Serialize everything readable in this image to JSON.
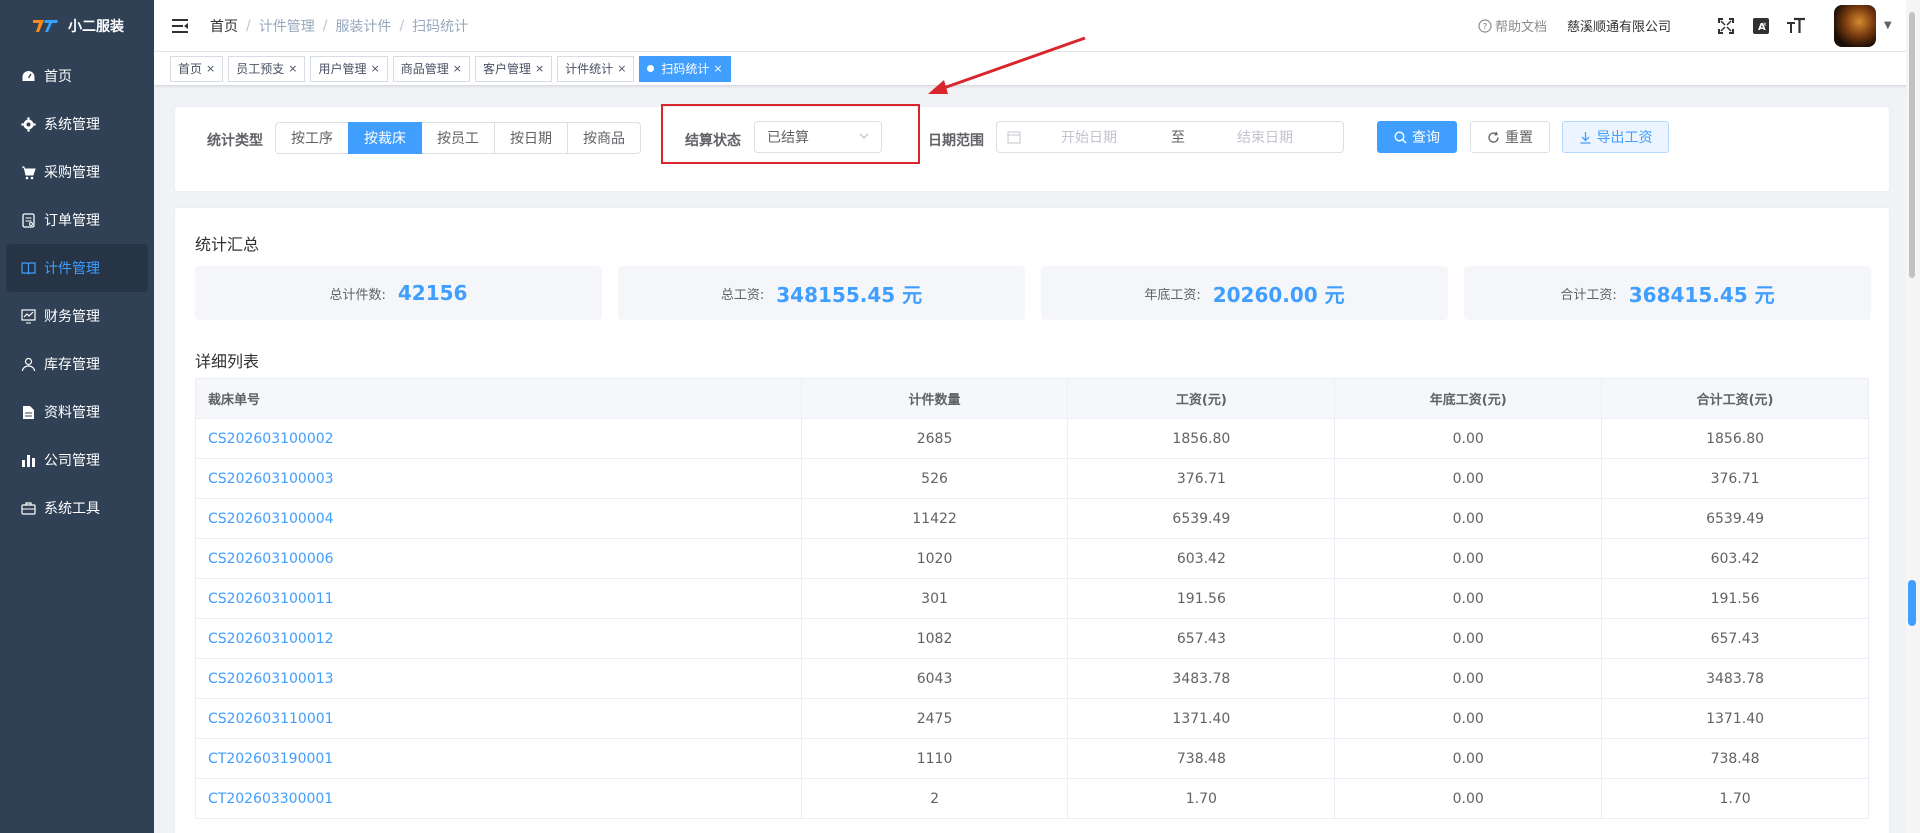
{
  "app": {
    "name": "小二服装"
  },
  "sidebar": {
    "items": [
      {
        "label": "首页",
        "icon": "dashboard-icon",
        "active": false
      },
      {
        "label": "系统管理",
        "icon": "gear-icon",
        "active": false
      },
      {
        "label": "采购管理",
        "icon": "cart-icon",
        "active": false
      },
      {
        "label": "订单管理",
        "icon": "order-icon",
        "active": false
      },
      {
        "label": "计件管理",
        "icon": "book-icon",
        "active": true
      },
      {
        "label": "财务管理",
        "icon": "chart-line-icon",
        "active": false
      },
      {
        "label": "库存管理",
        "icon": "user-icon",
        "active": false
      },
      {
        "label": "资料管理",
        "icon": "document-icon",
        "active": false
      },
      {
        "label": "公司管理",
        "icon": "bar-chart-icon",
        "active": false
      },
      {
        "label": "系统工具",
        "icon": "toolbox-icon",
        "active": false
      }
    ]
  },
  "header": {
    "breadcrumb": [
      "首页",
      "计件管理",
      "服装计件",
      "扫码统计"
    ],
    "help": "帮助文档",
    "company": "慈溪顺通有限公司"
  },
  "tags": [
    {
      "label": "首页",
      "active": false
    },
    {
      "label": "员工预支",
      "active": false
    },
    {
      "label": "用户管理",
      "active": false
    },
    {
      "label": "商品管理",
      "active": false
    },
    {
      "label": "客户管理",
      "active": false
    },
    {
      "label": "计件统计",
      "active": false
    },
    {
      "label": "扫码统计",
      "active": true
    }
  ],
  "filters": {
    "type_label": "统计类型",
    "type_options": [
      "按工序",
      "按裁床",
      "按员工",
      "按日期",
      "按商品"
    ],
    "type_active_index": 1,
    "status_label": "结算状态",
    "status_value": "已结算",
    "date_label": "日期范围",
    "date_start_placeholder": "开始日期",
    "date_separator": "至",
    "date_end_placeholder": "结束日期",
    "search_btn": "查询",
    "reset_btn": "重置",
    "export_btn": "导出工资"
  },
  "summary": {
    "title": "统计汇总",
    "stats": [
      {
        "label": "总计件数:",
        "value": "42156"
      },
      {
        "label": "总工资:",
        "value": "348155.45 元"
      },
      {
        "label": "年底工资:",
        "value": "20260.00 元"
      },
      {
        "label": "合计工资:",
        "value": "368415.45 元"
      }
    ]
  },
  "detail": {
    "title": "详细列表",
    "columns": [
      "裁床单号",
      "计件数量",
      "工资(元)",
      "年底工资(元)",
      "合计工资(元)"
    ],
    "rows": [
      [
        "CS202603100002",
        "2685",
        "1856.80",
        "0.00",
        "1856.80"
      ],
      [
        "CS202603100003",
        "526",
        "376.71",
        "0.00",
        "376.71"
      ],
      [
        "CS202603100004",
        "11422",
        "6539.49",
        "0.00",
        "6539.49"
      ],
      [
        "CS202603100006",
        "1020",
        "603.42",
        "0.00",
        "603.42"
      ],
      [
        "CS202603100011",
        "301",
        "191.56",
        "0.00",
        "191.56"
      ],
      [
        "CS202603100012",
        "1082",
        "657.43",
        "0.00",
        "657.43"
      ],
      [
        "CS202603100013",
        "6043",
        "3483.78",
        "0.00",
        "3483.78"
      ],
      [
        "CS202603110001",
        "2475",
        "1371.40",
        "0.00",
        "1371.40"
      ],
      [
        "CT202603190001",
        "1110",
        "738.48",
        "0.00",
        "738.48"
      ],
      [
        "CT202603300001",
        "2",
        "1.70",
        "0.00",
        "1.70"
      ]
    ]
  },
  "colors": {
    "primary": "#409eff",
    "sidebar": "#304156",
    "highlight": "#d9262c"
  }
}
